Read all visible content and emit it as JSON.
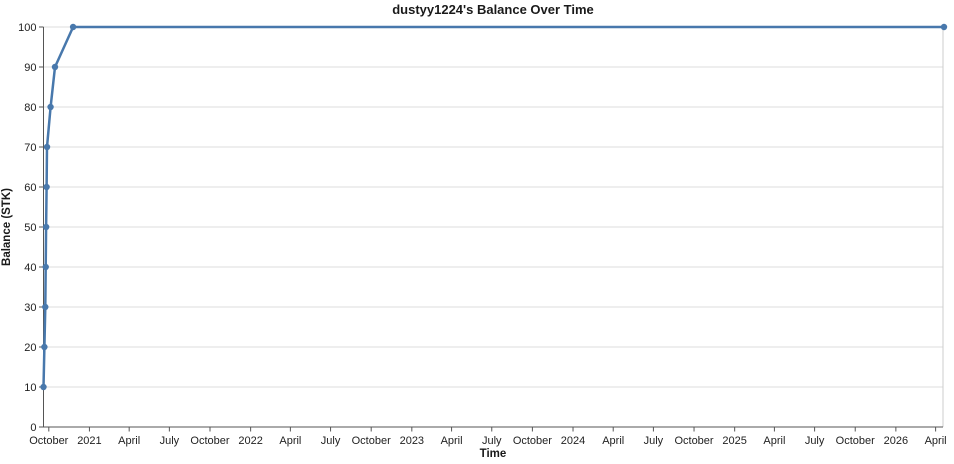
{
  "page": {
    "background": "#ffffff"
  },
  "chart_data": {
    "type": "line",
    "title": "dustyy1224's Balance Over Time",
    "xlabel": "Time",
    "ylabel": "Balance (STK)",
    "legend": "none",
    "grid": "horizontal-only",
    "ylim": [
      0,
      100
    ],
    "y_ticks": [
      0,
      10,
      20,
      30,
      40,
      50,
      60,
      70,
      80,
      90,
      100
    ],
    "x_ticks": [
      {
        "label": "October",
        "date": "2020-10-01"
      },
      {
        "label": "2021",
        "date": "2021-01-01"
      },
      {
        "label": "April",
        "date": "2021-04-01"
      },
      {
        "label": "July",
        "date": "2021-07-01"
      },
      {
        "label": "October",
        "date": "2021-10-01"
      },
      {
        "label": "2022",
        "date": "2022-01-01"
      },
      {
        "label": "April",
        "date": "2022-04-01"
      },
      {
        "label": "July",
        "date": "2022-07-01"
      },
      {
        "label": "October",
        "date": "2022-10-01"
      },
      {
        "label": "2023",
        "date": "2023-01-01"
      },
      {
        "label": "April",
        "date": "2023-04-01"
      },
      {
        "label": "July",
        "date": "2023-07-01"
      },
      {
        "label": "October",
        "date": "2023-10-01"
      },
      {
        "label": "2024",
        "date": "2024-01-01"
      },
      {
        "label": "April",
        "date": "2024-04-01"
      },
      {
        "label": "July",
        "date": "2024-07-01"
      },
      {
        "label": "October",
        "date": "2024-10-01"
      },
      {
        "label": "2025",
        "date": "2025-01-01"
      },
      {
        "label": "April",
        "date": "2025-04-01"
      },
      {
        "label": "July",
        "date": "2025-07-01"
      },
      {
        "label": "October",
        "date": "2025-10-01"
      },
      {
        "label": "2026",
        "date": "2026-01-01"
      },
      {
        "label": "April",
        "date": "2026-04-01"
      }
    ],
    "points": [
      {
        "date": "2020-09-19",
        "value": 10
      },
      {
        "date": "2020-09-21",
        "value": 20
      },
      {
        "date": "2020-09-23",
        "value": 30
      },
      {
        "date": "2020-09-24",
        "value": 40
      },
      {
        "date": "2020-09-25",
        "value": 50
      },
      {
        "date": "2020-09-26",
        "value": 60
      },
      {
        "date": "2020-09-27",
        "value": 70
      },
      {
        "date": "2020-10-05",
        "value": 80
      },
      {
        "date": "2020-10-15",
        "value": 90
      },
      {
        "date": "2020-11-25",
        "value": 100
      },
      {
        "date": "2026-04-20",
        "value": 100
      }
    ],
    "colors": {
      "line": "#4878ac",
      "marker": "#4878ac",
      "gridline": "#dcdcdc",
      "spine": "#555555",
      "right_border": "#cccccc",
      "tick": "#555555",
      "text": "#1a1a1a"
    }
  }
}
